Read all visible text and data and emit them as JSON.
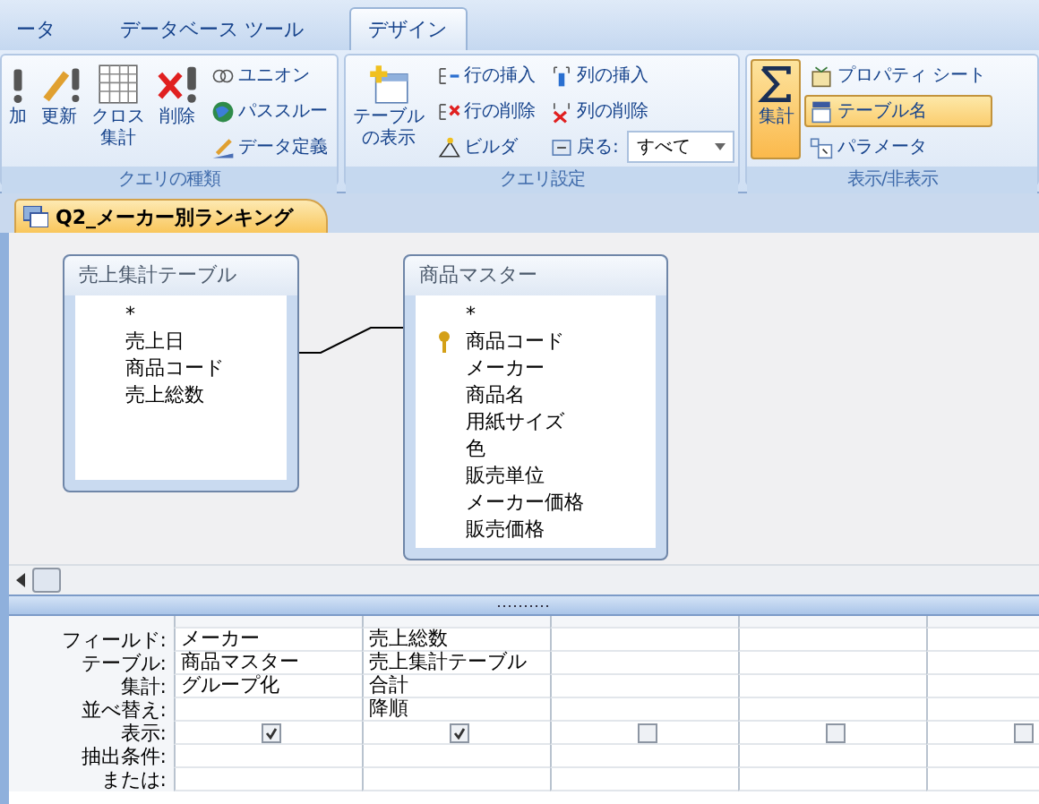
{
  "ribbon_tabs": [
    {
      "label": "ータ",
      "selected": false
    },
    {
      "label": "データベース ツール",
      "selected": false
    },
    {
      "label": "デザイン",
      "selected": true
    }
  ],
  "groups": [
    {
      "label": "クエリの種類",
      "items": [
        {
          "kind": "large",
          "label": "加",
          "selected": false
        },
        {
          "kind": "large",
          "label": "更新",
          "selected": false
        },
        {
          "kind": "large",
          "label_lines": [
            "クロス",
            "集計"
          ],
          "selected": false
        },
        {
          "kind": "large",
          "label": "削除",
          "selected": false
        },
        {
          "kind": "small",
          "label": "ユニオン",
          "selected": false
        },
        {
          "kind": "small",
          "label": "パススルー",
          "selected": false
        },
        {
          "kind": "small",
          "label": "データ定義",
          "selected": false
        }
      ]
    },
    {
      "label": "クエリ設定",
      "items": [
        {
          "kind": "large",
          "label_lines": [
            "テーブル",
            "の表示"
          ],
          "selected": false
        },
        {
          "kind": "small",
          "label": "行の挿入",
          "selected": false
        },
        {
          "kind": "small",
          "label": "行の削除",
          "selected": false
        },
        {
          "kind": "small",
          "label": "ビルダ",
          "selected": false
        },
        {
          "kind": "small",
          "label": "列の挿入",
          "selected": false
        },
        {
          "kind": "small",
          "label": "列の削除",
          "selected": false
        },
        {
          "kind": "dropdown",
          "label": "戻る:",
          "value": "すべて",
          "selected": false
        }
      ]
    },
    {
      "label": "表示/非表示",
      "items": [
        {
          "kind": "large",
          "label": "集計",
          "selected": true
        },
        {
          "kind": "small",
          "label": "プロパティ シート",
          "selected": false
        },
        {
          "kind": "small",
          "label": "テーブル名",
          "selected": true
        },
        {
          "kind": "small",
          "label": "パラメータ",
          "selected": false
        }
      ]
    }
  ],
  "document_tab": {
    "title": "Q2_メーカー別ランキング"
  },
  "tables": [
    {
      "title": "売上集計テーブル",
      "fields": [
        {
          "name": "*",
          "primary_key": false
        },
        {
          "name": "売上日",
          "primary_key": false
        },
        {
          "name": "商品コード",
          "primary_key": false
        },
        {
          "name": "売上総数",
          "primary_key": false
        }
      ]
    },
    {
      "title": "商品マスター",
      "fields": [
        {
          "name": "*",
          "primary_key": false
        },
        {
          "name": "商品コード",
          "primary_key": true
        },
        {
          "name": "メーカー",
          "primary_key": false
        },
        {
          "name": "商品名",
          "primary_key": false
        },
        {
          "name": "用紙サイズ",
          "primary_key": false
        },
        {
          "name": "色",
          "primary_key": false
        },
        {
          "name": "販売単位",
          "primary_key": false
        },
        {
          "name": "メーカー価格",
          "primary_key": false
        },
        {
          "name": "販売価格",
          "primary_key": false
        }
      ]
    }
  ],
  "grid": {
    "row_labels": [
      "フィールド:",
      "テーブル:",
      "集計:",
      "並べ替え:",
      "表示:",
      "抽出条件:",
      "または:"
    ],
    "columns": [
      {
        "field": "メーカー",
        "table": "商品マスター",
        "total": "グループ化",
        "show": true
      },
      {
        "field": "売上総数",
        "table": "売上集計テーブル",
        "total": "合計",
        "sort": "降順",
        "show": true
      },
      {
        "show": false
      },
      {
        "show": false
      },
      {
        "show": false
      }
    ]
  }
}
